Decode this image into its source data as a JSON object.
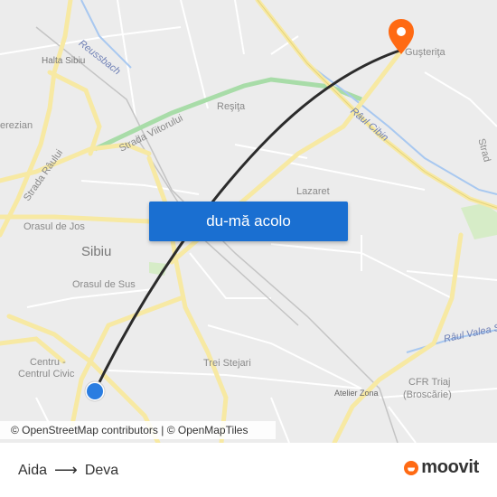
{
  "map": {
    "labels": {
      "halta_sibiu": "Halta Sibiu",
      "reussbach": "Reussbach",
      "gusterita": "Guşteriţa",
      "terezian": "erezian",
      "resita": "Reşiţa",
      "raul_cibin": "Râul Cibin",
      "strada_viitorului": "Strada Viitorului",
      "strada_raului": "Strada Râului",
      "lazaret": "Lazaret",
      "strada_right": "Strad",
      "orasul_de_jos": "Orasul de Jos",
      "sibiu": "Sibiu",
      "orasul_de_sus": "Orasul de Sus",
      "raul_valea": "Râul Valea S",
      "centru": "Centru -",
      "centrul_civic": "Centrul Civic",
      "trei_stejari": "Trei Stejari",
      "atelier_zona": "Atelier Zona",
      "cfr_triaj": "CFR Triaj",
      "broscarie": "(Broscărie)"
    },
    "cta_label": "du-mă acolo",
    "attribution": "© OpenStreetMap contributors | © OpenMapTiles",
    "colors": {
      "route": "#2b2b2b",
      "origin": "#2a7de1",
      "destination": "#ff6a13",
      "cta": "#1a6fd1",
      "major_road": "#f7e9a3"
    }
  },
  "footer": {
    "origin": "Aida",
    "arrow": "⟶",
    "destination": "Deva",
    "brand": "moovit"
  }
}
